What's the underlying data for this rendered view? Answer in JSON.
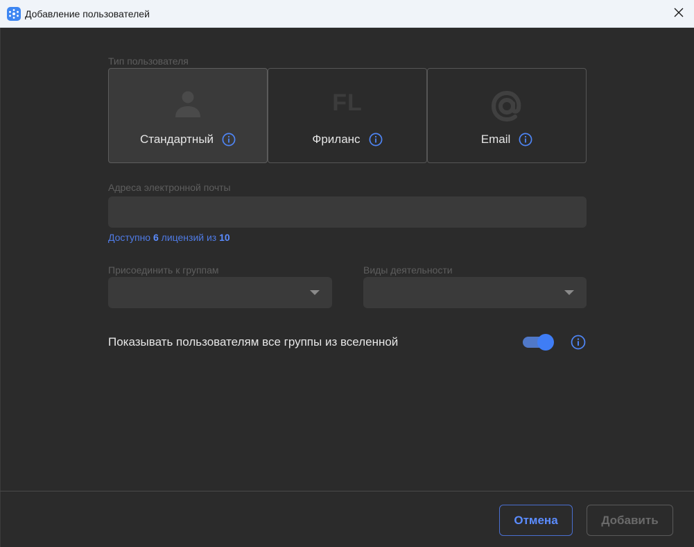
{
  "window": {
    "title": "Добавление пользователей",
    "close_icon": "close-icon",
    "app_icon": "app-logo-icon"
  },
  "user_type": {
    "label": "Тип пользователя",
    "options": [
      {
        "label": "Стандартный",
        "icon": "person-icon",
        "selected": true
      },
      {
        "label": "Фриланс",
        "icon": "fl-badge-icon",
        "icon_text": "FL",
        "selected": false
      },
      {
        "label": "Email",
        "icon": "at-sign-icon",
        "selected": false
      }
    ]
  },
  "email_field": {
    "label": "Адреса электронной почты",
    "value": "",
    "placeholder": ""
  },
  "licenses": {
    "prefix": "Доступно",
    "available": "6",
    "middle": "лицензий из",
    "total": "10"
  },
  "groups": {
    "label": "Присоединить к группам",
    "value": ""
  },
  "activities": {
    "label": "Виды деятельности",
    "value": ""
  },
  "show_groups": {
    "label": "Показывать пользователям все группы из вселенной",
    "enabled": true
  },
  "footer": {
    "cancel_label": "Отмена",
    "add_label": "Добавить"
  },
  "colors": {
    "accent": "#3f7df5",
    "background": "#2b2b2b",
    "field": "#3a3a3a"
  }
}
